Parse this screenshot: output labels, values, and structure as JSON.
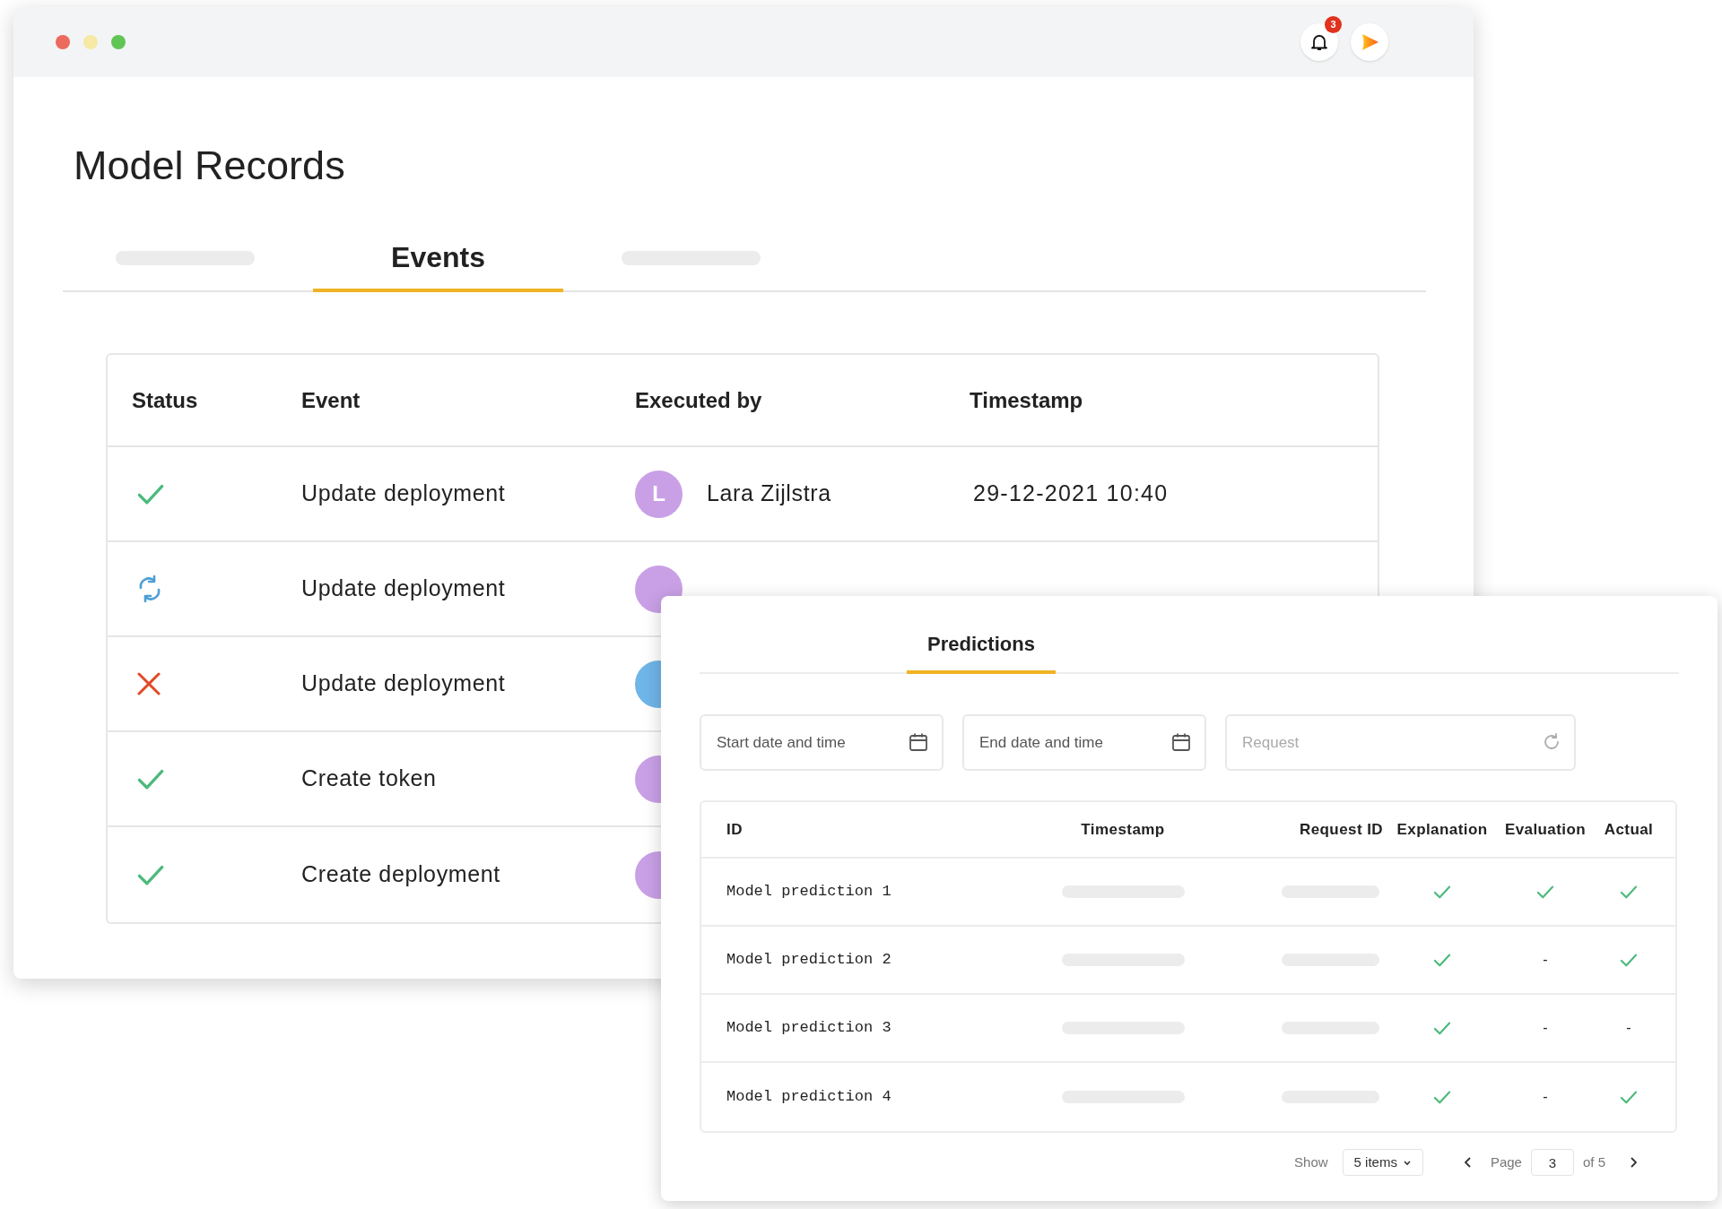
{
  "window": {
    "notifications": {
      "count": "3"
    }
  },
  "title": "Model Records",
  "tabs": [
    {
      "kind": "skeleton",
      "selected": false
    },
    {
      "kind": "label",
      "label": "Events",
      "selected": true
    },
    {
      "kind": "skeleton",
      "selected": false
    }
  ],
  "events": {
    "columns": [
      "Status",
      "Event",
      "Executed by",
      "Timestamp"
    ],
    "rows": [
      {
        "kind": "success",
        "event": "Update deployment",
        "avatar": {
          "initial": "L",
          "color": "#c9a0e6"
        },
        "name": "Lara Zijlstra",
        "timestamp": "29-12-2021 10:40"
      },
      {
        "kind": "syncing",
        "event": "Update deployment",
        "avatar": {
          "color": "#c9a0e6"
        }
      },
      {
        "kind": "failed",
        "event": "Update deployment",
        "avatar": {
          "color": "#6fb5e8"
        }
      },
      {
        "kind": "success",
        "event": "Create token",
        "avatar": {
          "color": "#c9a0e6"
        }
      },
      {
        "kind": "success",
        "event": "Create deployment",
        "avatar": {
          "color": "#c9a0e6"
        }
      }
    ]
  },
  "predictions": {
    "tab": {
      "label": "Predictions",
      "selected": true
    },
    "filters": [
      {
        "kind": "date",
        "placeholder": "Start date and time"
      },
      {
        "kind": "date",
        "placeholder": "End date and time"
      },
      {
        "kind": "request",
        "placeholder": "Request"
      }
    ],
    "columns": [
      "ID",
      "Timestamp",
      "Request ID",
      "Explanation",
      "Evaluation",
      "Actual"
    ],
    "rows": [
      {
        "id": "Model prediction 1",
        "explanation": {
          "kind": "check"
        },
        "evaluation": {
          "kind": "check"
        },
        "actual": {
          "kind": "check"
        }
      },
      {
        "id": "Model prediction 2",
        "explanation": {
          "kind": "check"
        },
        "evaluation": {
          "kind": "text",
          "text": "-"
        },
        "actual": {
          "kind": "check"
        }
      },
      {
        "id": "Model prediction 3",
        "explanation": {
          "kind": "check"
        },
        "evaluation": {
          "kind": "text",
          "text": "-"
        },
        "actual": {
          "kind": "text",
          "text": "-"
        }
      },
      {
        "id": "Model prediction 4",
        "explanation": {
          "kind": "check"
        },
        "evaluation": {
          "kind": "text",
          "text": "-"
        },
        "actual": {
          "kind": "check"
        }
      }
    ],
    "footer": {
      "show_label": "Show",
      "page_size": "5 items",
      "page_label": "Page",
      "page": "3",
      "of": "of 5"
    }
  }
}
